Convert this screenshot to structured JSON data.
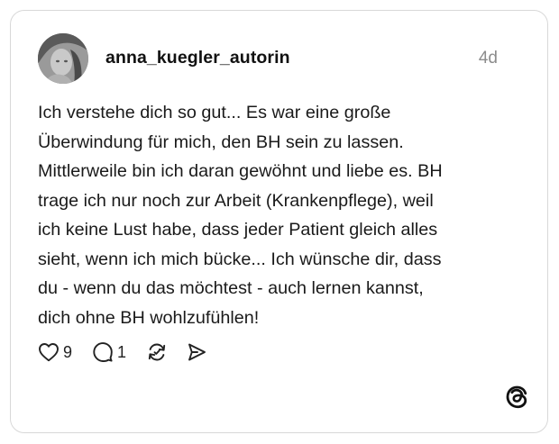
{
  "post": {
    "username": "anna_kuegler_autorin",
    "time": "4d",
    "lines": [
      "Ich verstehe dich so gut... Es war eine große",
      "Überwindung für mich, den BH sein zu lassen.",
      "Mittlerweile bin ich daran gewöhnt und liebe es. BH",
      "trage ich nur noch zur Arbeit (Krankenpflege), weil",
      "ich keine Lust habe, dass jeder Patient gleich alles",
      "sieht, wenn ich mich bücke... Ich wünsche dir, dass",
      "du - wenn du das möchtest - auch lernen kannst,",
      "dich ohne BH wohlzufühlen!"
    ]
  },
  "actions": {
    "like_count": "9",
    "reply_count": "1"
  },
  "icons": {
    "like": "heart-icon",
    "reply": "comment-icon",
    "repost": "repost-icon",
    "share": "send-icon",
    "brand": "threads-logo-icon"
  },
  "colors": {
    "text": "#1a1a1a",
    "muted": "#8c8c8c",
    "border": "#d8d8d8"
  }
}
